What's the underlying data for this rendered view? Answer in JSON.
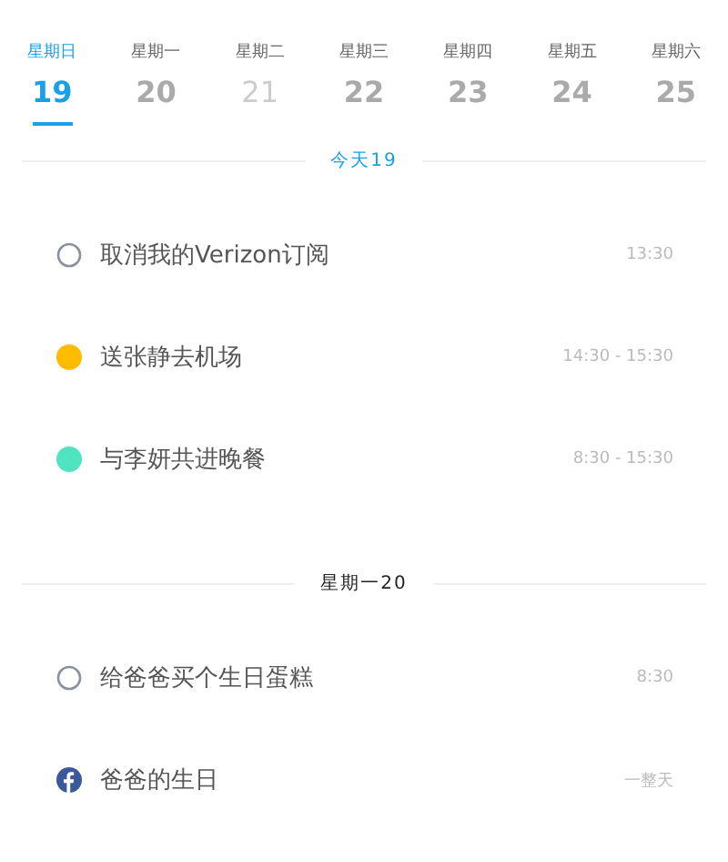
{
  "week": [
    {
      "weekday": "星期日",
      "day": "19",
      "selected": true,
      "dimmed": false
    },
    {
      "weekday": "星期一",
      "day": "20",
      "selected": false,
      "dimmed": false
    },
    {
      "weekday": "星期二",
      "day": "21",
      "selected": false,
      "dimmed": true
    },
    {
      "weekday": "星期三",
      "day": "22",
      "selected": false,
      "dimmed": false
    },
    {
      "weekday": "星期四",
      "day": "23",
      "selected": false,
      "dimmed": false
    },
    {
      "weekday": "星期五",
      "day": "24",
      "selected": false,
      "dimmed": false
    },
    {
      "weekday": "星期六",
      "day": "25",
      "selected": false,
      "dimmed": false
    }
  ],
  "sections": [
    {
      "title": "今天19",
      "today": true,
      "events": [
        {
          "kind": "task",
          "title": "取消我的Verizon订阅",
          "time": "13:30"
        },
        {
          "kind": "event",
          "color": "#ffbb00",
          "title": "送张静去机场",
          "time": "14:30 - 15:30"
        },
        {
          "kind": "event",
          "color": "#50e3c2",
          "title": "与李妍共进晚餐",
          "time": "8:30 - 15:30"
        }
      ]
    },
    {
      "title": "星期一20",
      "today": false,
      "events": [
        {
          "kind": "task",
          "title": "给爸爸买个生日蛋糕",
          "time": "8:30"
        },
        {
          "kind": "facebook",
          "title": "爸爸的生日",
          "time": "一整天"
        }
      ]
    }
  ]
}
